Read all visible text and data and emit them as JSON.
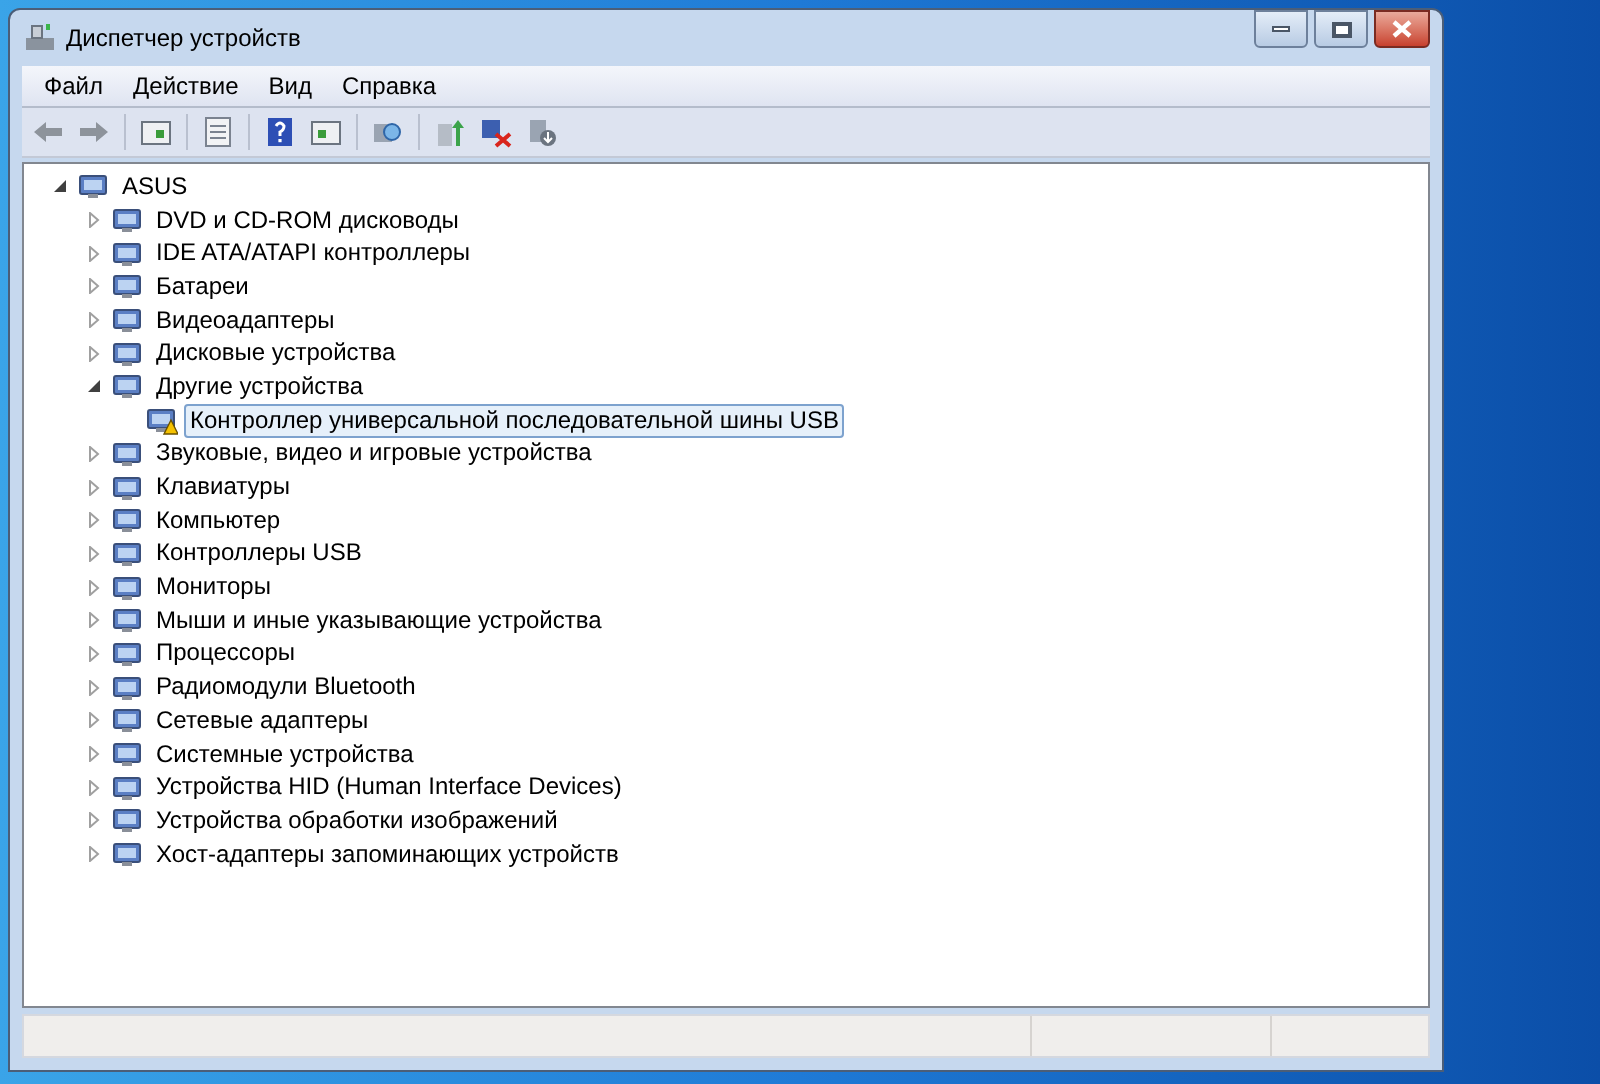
{
  "window": {
    "title": "Диспетчер устройств"
  },
  "menu": [
    {
      "label": "Файл"
    },
    {
      "label": "Действие"
    },
    {
      "label": "Вид"
    },
    {
      "label": "Справка"
    }
  ],
  "tree": {
    "label": "ASUS",
    "expanded": true,
    "selected": false,
    "children": [
      {
        "label": "DVD и CD-ROM дисководы",
        "expanded": false,
        "selected": false
      },
      {
        "label": "IDE ATA/ATAPI контроллеры",
        "expanded": false,
        "selected": false
      },
      {
        "label": "Батареи",
        "expanded": false,
        "selected": false
      },
      {
        "label": "Видеоадаптеры",
        "expanded": false,
        "selected": false
      },
      {
        "label": "Дисковые устройства",
        "expanded": false,
        "selected": false
      },
      {
        "label": "Другие устройства",
        "expanded": true,
        "selected": false,
        "children": [
          {
            "label": "Контроллер универсальной последовательной шины USB",
            "selected": true
          }
        ]
      },
      {
        "label": "Звуковые, видео и игровые устройства",
        "expanded": false,
        "selected": false
      },
      {
        "label": "Клавиатуры",
        "expanded": false,
        "selected": false
      },
      {
        "label": "Компьютер",
        "expanded": false,
        "selected": false
      },
      {
        "label": "Контроллеры USB",
        "expanded": false,
        "selected": false
      },
      {
        "label": "Мониторы",
        "expanded": false,
        "selected": false
      },
      {
        "label": "Мыши и иные указывающие устройства",
        "expanded": false,
        "selected": false
      },
      {
        "label": "Процессоры",
        "expanded": false,
        "selected": false
      },
      {
        "label": "Радиомодули Bluetooth",
        "expanded": false,
        "selected": false
      },
      {
        "label": "Сетевые адаптеры",
        "expanded": false,
        "selected": false
      },
      {
        "label": "Системные устройства",
        "expanded": false,
        "selected": false
      },
      {
        "label": "Устройства HID (Human Interface Devices)",
        "expanded": false,
        "selected": false
      },
      {
        "label": "Устройства обработки изображений",
        "expanded": false,
        "selected": false
      },
      {
        "label": "Хост-адаптеры запоминающих устройств",
        "expanded": false,
        "selected": false
      }
    ]
  }
}
